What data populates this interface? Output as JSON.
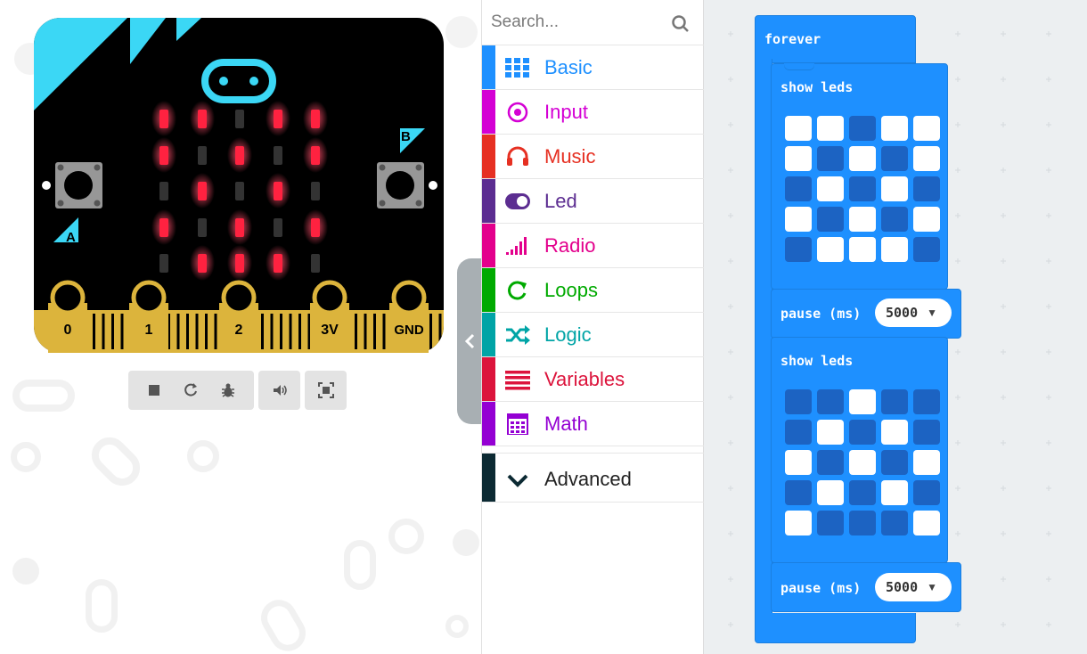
{
  "simulator": {
    "pins": [
      "0",
      "1",
      "2",
      "3V",
      "GND"
    ],
    "button_a_label": "A",
    "button_b_label": "B",
    "display_on": [
      [
        1,
        1,
        0,
        1,
        1
      ],
      [
        1,
        0,
        1,
        0,
        1
      ],
      [
        0,
        1,
        0,
        1,
        0
      ],
      [
        1,
        0,
        1,
        0,
        1
      ],
      [
        0,
        1,
        1,
        1,
        0
      ]
    ],
    "controls": [
      "stop-icon",
      "restart-icon",
      "debug-icon",
      "mute-icon",
      "fullscreen-icon"
    ]
  },
  "toolbox": {
    "search_placeholder": "Search...",
    "categories": [
      {
        "label": "Basic",
        "color": "#1e90ff",
        "icon": "grid-icon"
      },
      {
        "label": "Input",
        "color": "#d400d4",
        "icon": "target-icon"
      },
      {
        "label": "Music",
        "color": "#e63022",
        "icon": "headphones-icon"
      },
      {
        "label": "Led",
        "color": "#5c2d91",
        "icon": "toggle-icon"
      },
      {
        "label": "Radio",
        "color": "#e3008c",
        "icon": "signal-bars-icon"
      },
      {
        "label": "Loops",
        "color": "#00aa00",
        "icon": "refresh-icon"
      },
      {
        "label": "Logic",
        "color": "#00a4a6",
        "icon": "shuffle-icon"
      },
      {
        "label": "Variables",
        "color": "#dc143c",
        "icon": "list-icon"
      },
      {
        "label": "Math",
        "color": "#9400d3",
        "icon": "calculator-icon"
      }
    ],
    "advanced": {
      "label": "Advanced",
      "color": "#0c2a33",
      "icon": "chevron-down-icon"
    }
  },
  "workspace": {
    "forever_label": "forever",
    "blocks": [
      {
        "label": "show leds",
        "leds": [
          [
            1,
            1,
            0,
            1,
            1
          ],
          [
            1,
            0,
            1,
            0,
            1
          ],
          [
            0,
            1,
            0,
            1,
            0
          ],
          [
            1,
            0,
            1,
            0,
            1
          ],
          [
            0,
            1,
            1,
            1,
            0
          ]
        ]
      },
      {
        "label": "pause (ms)",
        "value": "5000"
      },
      {
        "label": "show leds",
        "leds": [
          [
            0,
            0,
            1,
            0,
            0
          ],
          [
            0,
            1,
            0,
            1,
            0
          ],
          [
            1,
            0,
            1,
            0,
            1
          ],
          [
            0,
            1,
            0,
            1,
            0
          ],
          [
            1,
            0,
            0,
            0,
            1
          ]
        ]
      },
      {
        "label": "pause (ms)",
        "value": "5000"
      }
    ]
  }
}
